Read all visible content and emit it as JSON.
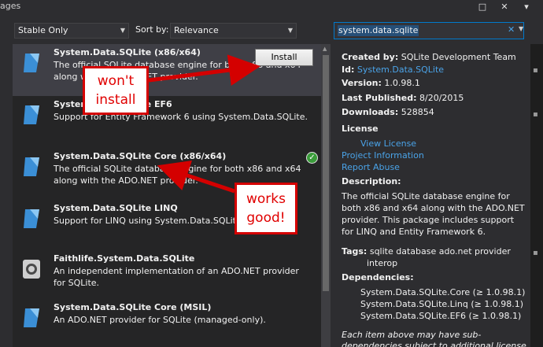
{
  "window": {
    "title_fragment": "ages",
    "maximize_glyph": "□",
    "close_glyph": "✕",
    "menu_glyph": "▾"
  },
  "toolbar": {
    "filter_value": "Stable Only",
    "sort_label": "Sort by:",
    "sort_value": "Relevance",
    "search_value": "system.data.sqlite",
    "clear_glyph": "✕"
  },
  "packages": [
    {
      "title": "System.Data.SQLite (x86/x64)",
      "description": "The official SQLite database engine for both x86 and x64 along with the ADO.NET provider.",
      "action": "Install"
    },
    {
      "title": "System.Data.SQLite EF6",
      "description": "Support for Entity Framework 6 using System.Data.SQLite."
    },
    {
      "title": "System.Data.SQLite Core (x86/x64)",
      "description": "The official SQLite database engine for both x86 and x64 along with the ADO.NET provider.",
      "installed_glyph": "✓"
    },
    {
      "title": "System.Data.SQLite LINQ",
      "description": "Support for LINQ using System.Data.SQLite."
    },
    {
      "title": "Faithlife.System.Data.SQLite",
      "description": "An independent implementation of an ADO.NET provider for SQLite."
    },
    {
      "title": "System.Data.SQLite Core (MSIL)",
      "description": "An ADO.NET provider for SQLite (managed-only)."
    }
  ],
  "details": {
    "created_by_label": "Created by:",
    "created_by": "SQLite Development Team",
    "id_label": "Id:",
    "id": "System.Data.SQLite",
    "version_label": "Version:",
    "version": "1.0.98.1",
    "published_label": "Last Published:",
    "published": "8/20/2015",
    "downloads_label": "Downloads:",
    "downloads": "528854",
    "license_label": "License",
    "view_license": "View License",
    "project_info": "Project Information",
    "report_abuse": "Report Abuse",
    "description_label": "Description:",
    "description": "The official SQLite database engine for both x86 and x64 along with the ADO.NET provider. This package includes support for LINQ and Entity Framework 6.",
    "tags_label": "Tags:",
    "tags_line1": "sqlite database ado.net provider",
    "tags_line2": "interop",
    "dependencies_label": "Dependencies:",
    "dependencies": [
      "System.Data.SQLite.Core (≥ 1.0.98.1)",
      "System.Data.SQLite.Linq (≥ 1.0.98.1)",
      "System.Data.SQLite.EF6 (≥ 1.0.98.1)"
    ],
    "footer_line1": "Each item above may have sub-",
    "footer_line2": "dependencies subject to additional license"
  },
  "annotations": {
    "wont_install": [
      "won't",
      "install"
    ],
    "works_good": [
      "works",
      "good!"
    ],
    "color": "#d40000"
  },
  "colors": {
    "background": "#2d2d30",
    "list_background": "#252526",
    "selected_row": "#3f3f46",
    "link": "#4aa3e8",
    "accent": "#007acc"
  }
}
